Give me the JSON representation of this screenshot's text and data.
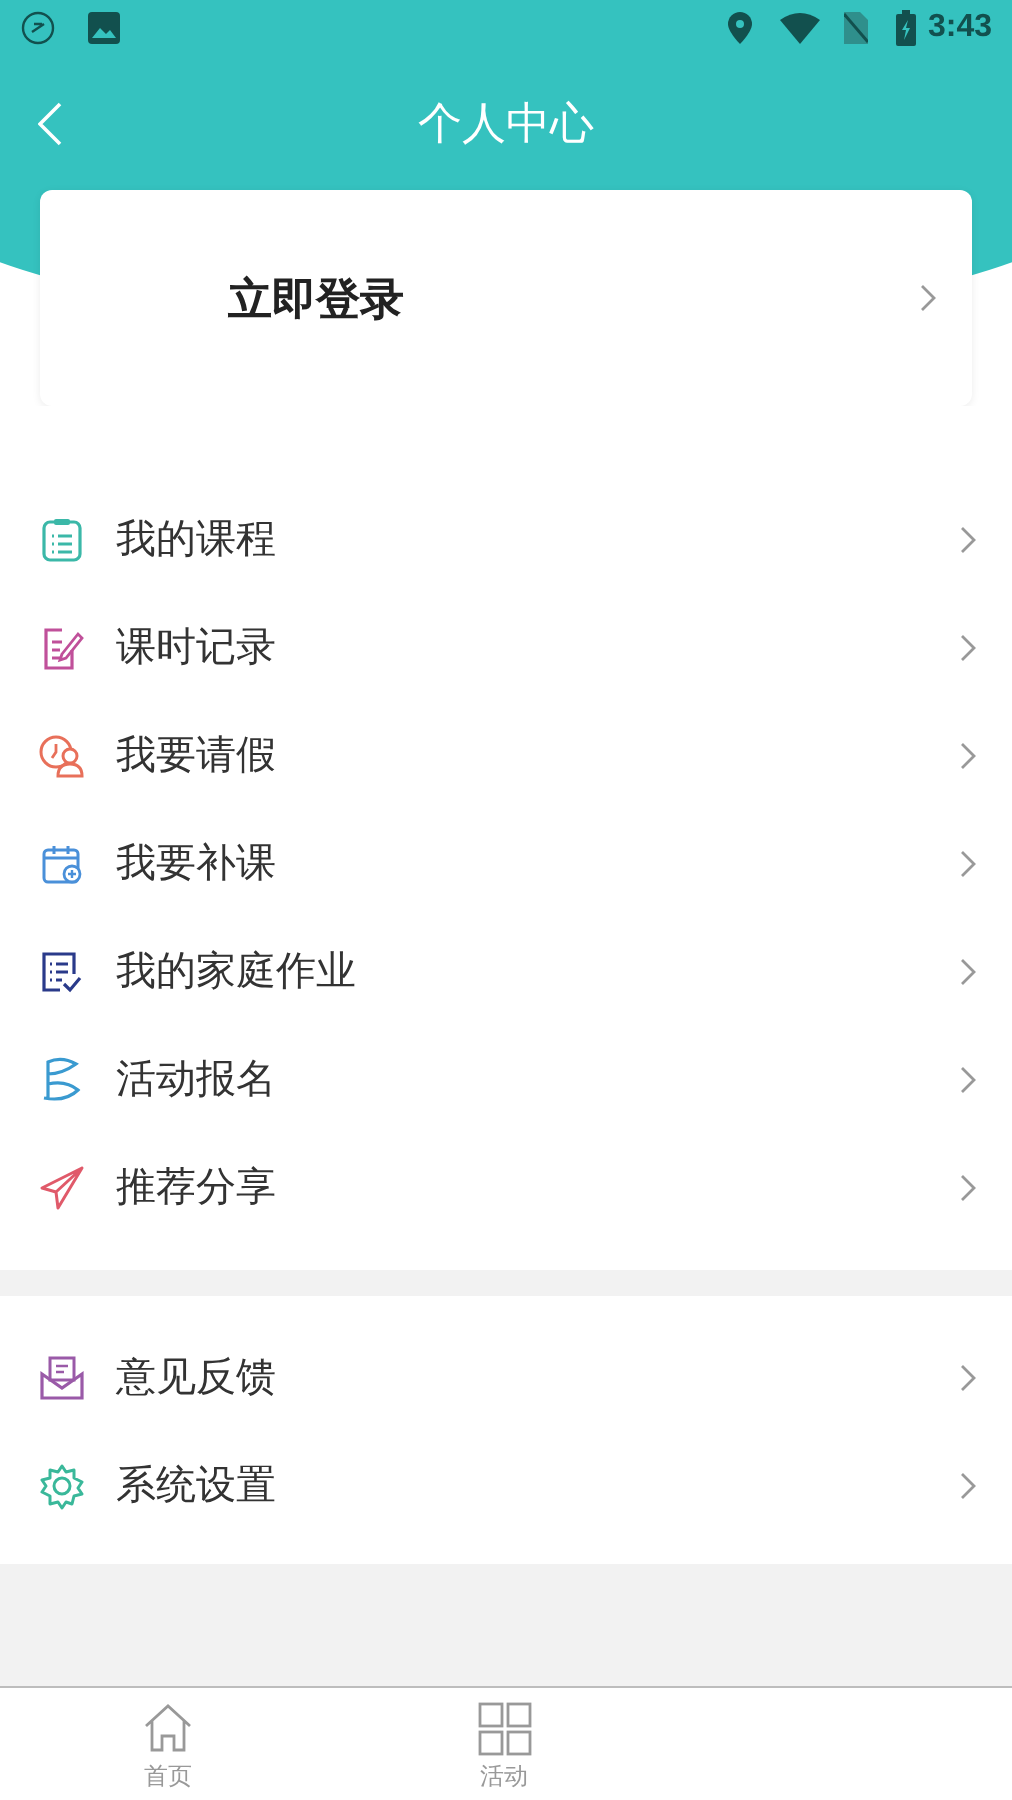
{
  "status_bar": {
    "time": "3:43"
  },
  "header": {
    "title": "个人中心"
  },
  "login_card": {
    "label": "立即登录"
  },
  "menu_sections": [
    {
      "items": [
        {
          "kind": "clipboard",
          "label": "我的课程",
          "color": "#3bb8a8"
        },
        {
          "kind": "edit",
          "label": "课时记录",
          "color": "#c0509a"
        },
        {
          "kind": "leave",
          "label": "我要请假",
          "color": "#e8705a"
        },
        {
          "kind": "calendar",
          "label": "我要补课",
          "color": "#4a90d9"
        },
        {
          "kind": "checklist",
          "label": "我的家庭作业",
          "color": "#2a3a8a"
        },
        {
          "kind": "flag",
          "label": "活动报名",
          "color": "#3a9ad0"
        },
        {
          "kind": "send",
          "label": "推荐分享",
          "color": "#e05a6a"
        }
      ]
    },
    {
      "items": [
        {
          "kind": "mail",
          "label": "意见反馈",
          "color": "#9a5aa8"
        },
        {
          "kind": "gear",
          "label": "系统设置",
          "color": "#3ab89a"
        }
      ]
    }
  ],
  "tab_bar": [
    {
      "kind": "home",
      "label": "首页",
      "selected": false
    },
    {
      "kind": "grid",
      "label": "活动",
      "selected": false
    }
  ]
}
